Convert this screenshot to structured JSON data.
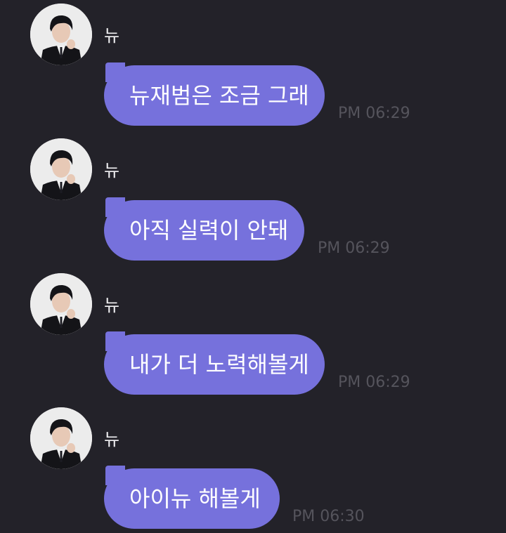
{
  "messages": [
    {
      "sender": "뉴",
      "text": "뉴재범은 조금 그래",
      "time": "PM 06:29"
    },
    {
      "sender": "뉴",
      "text": "아직 실력이 안돼",
      "time": "PM 06:29"
    },
    {
      "sender": "뉴",
      "text": "내가 더 노력해볼게",
      "time": "PM 06:29"
    },
    {
      "sender": "뉴",
      "text": "아이뉴 해볼게",
      "time": "PM 06:30"
    }
  ],
  "colors": {
    "background": "#232229",
    "bubble": "#7671dc",
    "timestamp": "#55545c",
    "sender_name": "#f2f2f4"
  }
}
